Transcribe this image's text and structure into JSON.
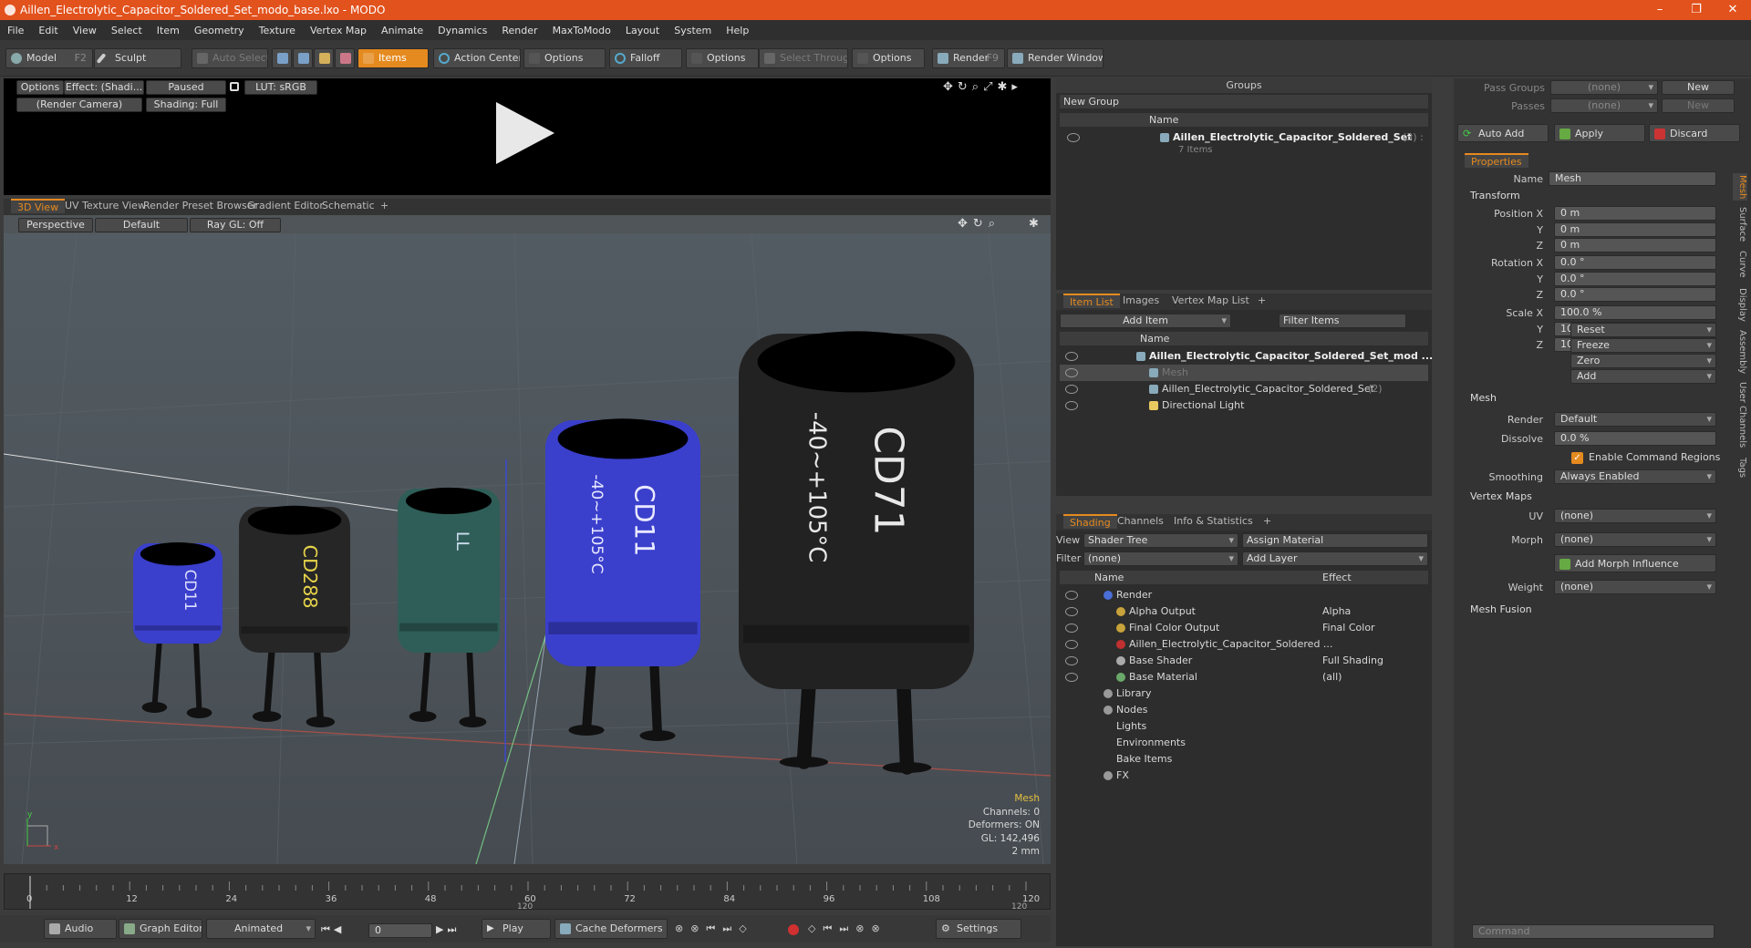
{
  "window": {
    "title": "Aillen_Electrolytic_Capacitor_Soldered_Set_modo_base.lxo - MODO",
    "min": "–",
    "max": "❐",
    "close": "✕"
  },
  "menu": [
    "File",
    "Edit",
    "View",
    "Select",
    "Item",
    "Geometry",
    "Texture",
    "Vertex Map",
    "Animate",
    "Dynamics",
    "Render",
    "MaxToModo",
    "Layout",
    "System",
    "Help"
  ],
  "toolbar": {
    "model": "Model",
    "model_key": "F2",
    "sculpt": "Sculpt",
    "auto_select": "Auto Select",
    "items": "Items",
    "action_center": "Action Center",
    "options1": "Options",
    "falloff": "Falloff",
    "options2": "Options",
    "select_through": "Select Through",
    "options3": "Options",
    "render": "Render",
    "render_key": "F9",
    "render_window": "Render Window"
  },
  "preview": {
    "options": "Options",
    "effect": "Effect: (Shadi...",
    "paused": "Paused",
    "lut": "LUT: sRGB",
    "camera": "(Render Camera)",
    "shading": "Shading: Full"
  },
  "viewport_tabs": [
    "3D View",
    "UV Texture View",
    "Render Preset Browser",
    "Gradient Editor",
    "Schematic",
    "+"
  ],
  "viewport": {
    "perspective": "Perspective",
    "default": "Default",
    "raygl": "Ray GL: Off",
    "info_title": "Mesh",
    "channels": "Channels: 0",
    "deformers": "Deformers: ON",
    "gl": "GL: 142,496",
    "size": "2 mm",
    "axis_y": "y",
    "axis_x": "x"
  },
  "capacitors": [
    {
      "body": "#3a3fcc",
      "text": "CD11",
      "color_text": "#dfe0ff"
    },
    {
      "body": "#262626",
      "text": "CD288",
      "color_text": "#e6d24a"
    },
    {
      "body": "#2f5e58",
      "text": "LL",
      "color_text": "#cde"
    },
    {
      "body": "#3a3fcc",
      "text": "CD11",
      "text2": "-40~+105°C",
      "color_text": "#e8e8ff"
    },
    {
      "body": "#222",
      "text": "CD71",
      "text2": "-40~+105°C",
      "color_text": "#e8e8e8"
    }
  ],
  "timeline": {
    "ticks": [
      "0",
      "12",
      "24",
      "36",
      "48",
      "60",
      "72",
      "84",
      "96",
      "108",
      "120"
    ],
    "end_label": "120",
    "mid_label": "120"
  },
  "bottom": {
    "audio": "Audio",
    "graph": "Graph Editor",
    "animated": "Animated",
    "frame": "0",
    "play": "Play",
    "cache": "Cache Deformers",
    "settings": "Settings"
  },
  "groups": {
    "title": "Groups",
    "new_group": "New Group",
    "col_name": "Name",
    "item": "Aillen_Electrolytic_Capacitor_Soldered_Set",
    "item_count": "(3) :",
    "item_sub": "7 Items"
  },
  "itemlist": {
    "tabs": [
      "Item List",
      "Images",
      "Vertex Map List",
      "+"
    ],
    "add_item": "Add Item",
    "filter": "Filter Items",
    "col_name": "Name",
    "rows": [
      {
        "label": "Aillen_Electrolytic_Capacitor_Soldered_Set_mod ...",
        "bold": true,
        "indent": 0
      },
      {
        "label": "Mesh",
        "bold": false,
        "indent": 1,
        "dim": true
      },
      {
        "label": "Aillen_Electrolytic_Capacitor_Soldered_Set",
        "extra": "(2)",
        "bold": false,
        "indent": 1
      },
      {
        "label": "Directional Light",
        "bold": false,
        "indent": 1
      }
    ]
  },
  "shading": {
    "tabs": [
      "Shading",
      "Channels",
      "Info & Statistics",
      "+"
    ],
    "view_label": "View",
    "view_value": "Shader Tree",
    "assign": "Assign Material",
    "filter_label": "Filter",
    "filter_value": "(none)",
    "add_layer": "Add Layer",
    "col_name": "Name",
    "col_effect": "Effect",
    "rows": [
      {
        "label": "Render",
        "effect": "",
        "indent": 0,
        "color": "#4a6fd6"
      },
      {
        "label": "Alpha Output",
        "effect": "Alpha",
        "indent": 1,
        "color": "#c8a23a"
      },
      {
        "label": "Final Color Output",
        "effect": "Final Color",
        "indent": 1,
        "color": "#c8a23a"
      },
      {
        "label": "Aillen_Electrolytic_Capacitor_Soldered ...",
        "effect": "",
        "indent": 1,
        "color": "#c03030"
      },
      {
        "label": "Base Shader",
        "effect": "Full Shading",
        "indent": 1,
        "color": "#aaaaaa"
      },
      {
        "label": "Base Material",
        "effect": "(all)",
        "indent": 1,
        "color": "#6aa86a"
      },
      {
        "label": "Library",
        "effect": "",
        "indent": 0,
        "color": "#999"
      },
      {
        "label": "Nodes",
        "effect": "",
        "indent": 0,
        "color": "#999"
      },
      {
        "label": "Lights",
        "effect": "",
        "indent": 0,
        "color": ""
      },
      {
        "label": "Environments",
        "effect": "",
        "indent": 0,
        "color": ""
      },
      {
        "label": "Bake Items",
        "effect": "",
        "indent": 0,
        "color": ""
      },
      {
        "label": "FX",
        "effect": "",
        "indent": 0,
        "color": "#999"
      }
    ]
  },
  "props": {
    "pass_groups": "Pass Groups",
    "pass_value": "(none)",
    "new": "New",
    "passes": "Passes",
    "passes_value": "(none)",
    "new2": "New",
    "auto_add": "Auto Add",
    "apply": "Apply",
    "discard": "Discard",
    "title": "Properties",
    "name_label": "Name",
    "name_value": "Mesh",
    "transform": "Transform",
    "pos_label": "Position X",
    "y": "Y",
    "z": "Z",
    "pos": [
      "0 m",
      "0 m",
      "0 m"
    ],
    "rot_label": "Rotation X",
    "rot": [
      "0.0 °",
      "0.0 °",
      "0.0 °"
    ],
    "scale_label": "Scale X",
    "scale": [
      "100.0 %",
      "100.0 %",
      "100.0 %"
    ],
    "reset": "Reset",
    "freeze": "Freeze",
    "zero": "Zero",
    "add": "Add",
    "mesh": "Mesh",
    "render_label": "Render",
    "render_value": "Default",
    "dissolve_label": "Dissolve",
    "dissolve_value": "0.0 %",
    "enable_cmd": "Enable Command Regions",
    "smoothing_label": "Smoothing",
    "smoothing_value": "Always Enabled",
    "vertex_maps": "Vertex Maps",
    "uv_label": "UV",
    "uv_value": "(none)",
    "morph_label": "Morph",
    "morph_value": "(none)",
    "add_morph": "Add Morph Influence",
    "weight_label": "Weight",
    "weight_value": "(none)",
    "mesh_fusion": "Mesh Fusion",
    "command": "Command",
    "vtabs": [
      "Mesh",
      "Surface",
      "Curve",
      "Display",
      "Assembly",
      "User Channels",
      "Tags"
    ]
  },
  "colors": {
    "accent": "#e58a1f",
    "titlebar": "#e2521d"
  }
}
